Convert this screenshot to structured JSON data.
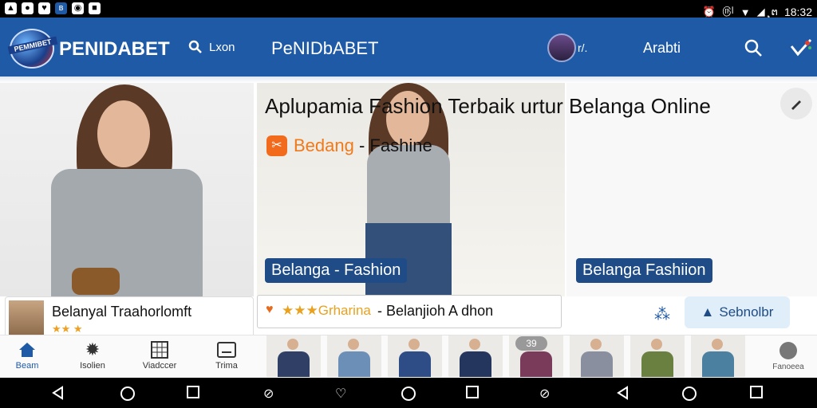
{
  "status_bar": {
    "time": "18:32",
    "signal_text": "௫୤",
    "battery_text": "ຸຕ",
    "left_icons": [
      "image-icon",
      "circle-app-icon",
      "heart-app-icon",
      "bluetooth-app-icon",
      "circle-app-icon-2",
      "square-app-icon"
    ]
  },
  "header": {
    "logo_text": "PEMMIBET",
    "brand": "PENIDABET",
    "search_label": "Lxon",
    "brand_secondary": "PeNIDbABET",
    "avatar_label": "r/.",
    "language": "Arabti"
  },
  "hero": {
    "headline": "Aplupamia Fashion Terbaik urtur Belanga Online",
    "sub_brand_highlight": "Bedang",
    "sub_brand_rest": "- Fashine",
    "tag_left": "Belanga - Fashion",
    "tag_right": "Belanga Fashiion"
  },
  "cards": {
    "left_title": "Belanyal Traahorlomft",
    "left_stars": "★★ ★",
    "mid_rating": "★★★Grharina",
    "mid_title": "- Belanjioh A dhon"
  },
  "actions": {
    "select_button": "Sebnolbr",
    "badge": "39"
  },
  "bottom_nav": {
    "items": [
      {
        "label": "Beam",
        "icon": "home-icon"
      },
      {
        "label": "Isolien",
        "icon": "gear-icon"
      },
      {
        "label": "Viadccer",
        "icon": "grid-icon"
      },
      {
        "label": "Trima",
        "icon": "card-icon"
      }
    ],
    "right_label": "Fanoeea"
  },
  "colors": {
    "header_blue": "#1f5aa6",
    "tag_navy": "#1f4c86",
    "accent_orange": "#f26b1d",
    "star_gold": "#e9a11e"
  }
}
